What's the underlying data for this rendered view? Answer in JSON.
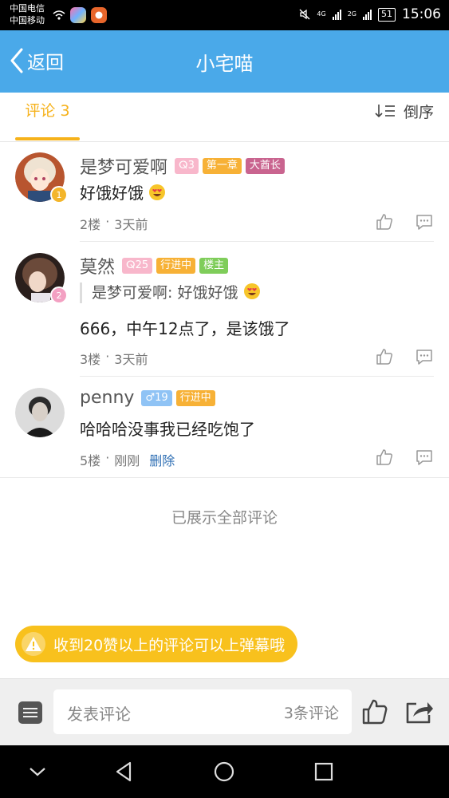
{
  "status_bar": {
    "carrier_1": "中国电信",
    "carrier_2": "中国移动",
    "net_1": "4G",
    "net_2": "2G",
    "battery": "51",
    "time": "15:06"
  },
  "header": {
    "back_label": "返回",
    "title": "小宅喵",
    "bg_color": "#4aa9e9"
  },
  "tabs": {
    "comments_label": "评论 3",
    "sort_label": "倒序",
    "accent_color": "#f6b21b"
  },
  "comments": [
    {
      "username": "是梦可爱啊",
      "level": "3",
      "tags": [
        "第一章",
        "大酋长"
      ],
      "badge": "1",
      "text": "好饿好饿",
      "emoji": "heart-eyes-emoji",
      "floor": "2楼",
      "time": "3天前"
    },
    {
      "username": "莫然",
      "level": "25",
      "tags": [
        "行进中",
        "楼主"
      ],
      "badge": "2",
      "quote": "是梦可爱啊: 好饿好饿",
      "quote_emoji": "heart-eyes-emoji",
      "text": "666，中午12点了，是该饿了",
      "floor": "3楼",
      "time": "3天前"
    },
    {
      "username": "penny",
      "level": "19",
      "gender": "♂",
      "tags": [
        "行进中"
      ],
      "text": "哈哈哈没事我已经吃饱了",
      "floor": "5楼",
      "time": "刚刚",
      "delete_label": "删除"
    }
  ],
  "end_note": "已展示全部评论",
  "tip": "收到20赞以上的评论可以上弹幕哦",
  "input_bar": {
    "placeholder": "发表评论",
    "count": "3条评论"
  },
  "icons": [
    "back-chevron-icon",
    "sort-icon",
    "like-icon",
    "reply-icon",
    "menu-icon",
    "thumb-up-icon",
    "share-icon",
    "warning-icon"
  ]
}
